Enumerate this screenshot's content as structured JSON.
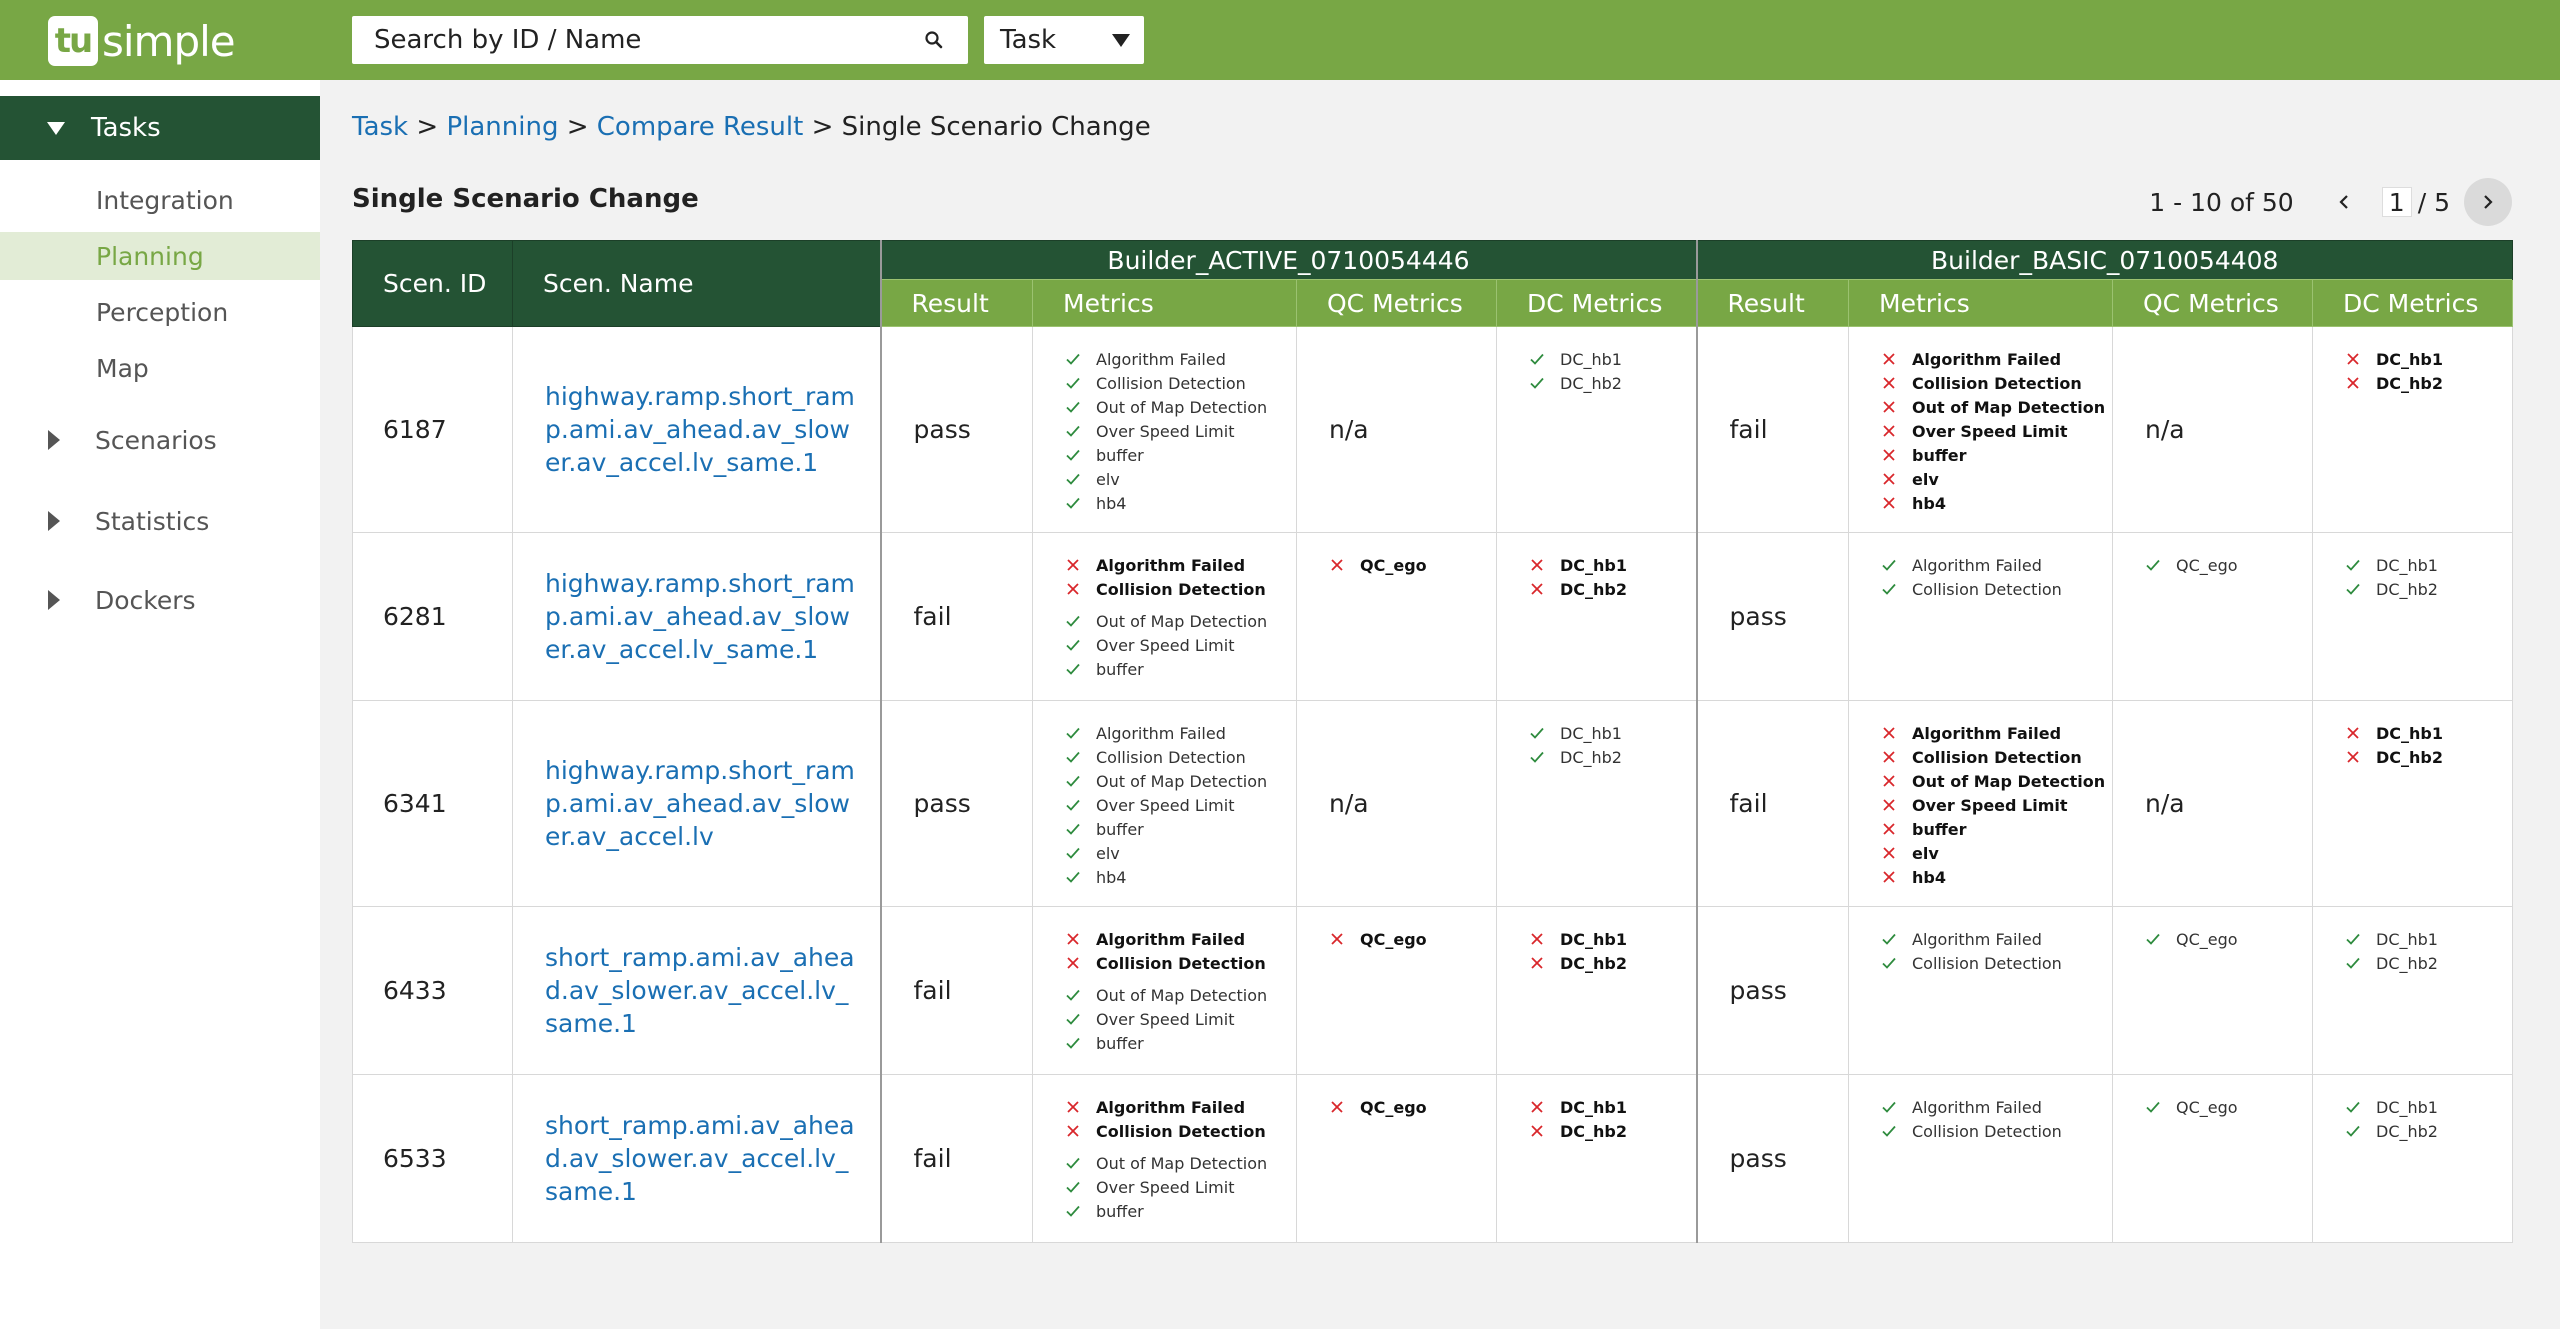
{
  "header": {
    "logo_badge": "tu",
    "logo_text": "simple",
    "search_placeholder": "Search by ID / Name",
    "search_icon": "magnifier",
    "type_select": "Task"
  },
  "sidebar": {
    "section": "Tasks",
    "sub_items": [
      "Integration",
      "Planning",
      "Perception",
      "Map"
    ],
    "active_item": "Planning",
    "groups": [
      "Scenarios",
      "Statistics",
      "Dockers"
    ]
  },
  "breadcrumb": {
    "items": [
      "Task",
      "Planning",
      "Compare Result"
    ],
    "current": "Single Scenario Change",
    "sep": ">"
  },
  "page_title": "Single Scenario Change",
  "pagination": {
    "range": "1 - 10 of 50",
    "page": "1",
    "total": "/ 5"
  },
  "table": {
    "col_id": "Scen. ID",
    "col_name": "Scen. Name",
    "builds": [
      "Builder_ACTIVE_0710054446",
      "Builder_BASIC_0710054408"
    ],
    "sub_cols": [
      "Result",
      "Metrics",
      "QC Metrics",
      "DC Metrics"
    ],
    "rows": [
      {
        "id": "6187",
        "name": "highway.ramp.short_ramp.ami.av_ahead.av_slower.av_accel.lv_same.1",
        "a": {
          "result": "pass",
          "qc": "n/a",
          "metrics": [
            [
              "Algorithm Failed",
              "ok"
            ],
            [
              "Collision Detection",
              "ok"
            ],
            [
              "Out of Map Detection",
              "ok"
            ],
            [
              "Over Speed Limit",
              "ok"
            ],
            [
              "buffer",
              "ok"
            ],
            [
              "elv",
              "ok"
            ],
            [
              "hb4",
              "ok"
            ]
          ],
          "dc": [
            [
              "DC_hb1",
              "ok"
            ],
            [
              "DC_hb2",
              "ok"
            ]
          ]
        },
        "b": {
          "result": "fail",
          "qc": "n/a",
          "metrics": [
            [
              "Algorithm Failed",
              "fail"
            ],
            [
              "Collision Detection",
              "fail"
            ],
            [
              "Out of Map Detection",
              "fail"
            ],
            [
              "Over Speed Limit",
              "fail"
            ],
            [
              "buffer",
              "fail"
            ],
            [
              "elv",
              "fail"
            ],
            [
              "hb4",
              "fail"
            ]
          ],
          "dc": [
            [
              "DC_hb1",
              "fail"
            ],
            [
              "DC_hb2",
              "fail"
            ]
          ]
        }
      },
      {
        "id": "6281",
        "name": "highway.ramp.short_ramp.ami.av_ahead.av_slower.av_accel.lv_same.1",
        "a": {
          "result": "fail",
          "qc": [
            [
              "QC_ego",
              "fail"
            ]
          ],
          "metrics": [
            [
              "Algorithm Failed",
              "fail"
            ],
            [
              "Collision Detection",
              "fail"
            ],
            [
              "Out of Map Detection",
              "ok"
            ],
            [
              "Over Speed Limit",
              "ok"
            ],
            [
              "buffer",
              "ok"
            ]
          ],
          "dc": [
            [
              "DC_hb1",
              "fail"
            ],
            [
              "DC_hb2",
              "fail"
            ]
          ]
        },
        "b": {
          "result": "pass",
          "qc": [
            [
              "QC_ego",
              "ok"
            ]
          ],
          "metrics": [
            [
              "Algorithm Failed",
              "ok"
            ],
            [
              "Collision Detection",
              "ok"
            ]
          ],
          "dc": [
            [
              "DC_hb1",
              "ok"
            ],
            [
              "DC_hb2",
              "ok"
            ]
          ]
        }
      },
      {
        "id": "6341",
        "name": "highway.ramp.short_ramp.ami.av_ahead.av_slower.av_accel.lv",
        "a": {
          "result": "pass",
          "qc": "n/a",
          "metrics": [
            [
              "Algorithm Failed",
              "ok"
            ],
            [
              "Collision Detection",
              "ok"
            ],
            [
              "Out of Map Detection",
              "ok"
            ],
            [
              "Over Speed Limit",
              "ok"
            ],
            [
              "buffer",
              "ok"
            ],
            [
              "elv",
              "ok"
            ],
            [
              "hb4",
              "ok"
            ]
          ],
          "dc": [
            [
              "DC_hb1",
              "ok"
            ],
            [
              "DC_hb2",
              "ok"
            ]
          ]
        },
        "b": {
          "result": "fail",
          "qc": "n/a",
          "metrics": [
            [
              "Algorithm Failed",
              "fail"
            ],
            [
              "Collision Detection",
              "fail"
            ],
            [
              "Out of Map Detection",
              "fail"
            ],
            [
              "Over Speed Limit",
              "fail"
            ],
            [
              "buffer",
              "fail"
            ],
            [
              "elv",
              "fail"
            ],
            [
              "hb4",
              "fail"
            ]
          ],
          "dc": [
            [
              "DC_hb1",
              "fail"
            ],
            [
              "DC_hb2",
              "fail"
            ]
          ]
        }
      },
      {
        "id": "6433",
        "name": "short_ramp.ami.av_ahead.av_slower.av_accel.lv_same.1",
        "a": {
          "result": "fail",
          "qc": [
            [
              "QC_ego",
              "fail"
            ]
          ],
          "metrics": [
            [
              "Algorithm Failed",
              "fail"
            ],
            [
              "Collision Detection",
              "fail"
            ],
            [
              "Out of Map Detection",
              "ok"
            ],
            [
              "Over Speed Limit",
              "ok"
            ],
            [
              "buffer",
              "ok"
            ]
          ],
          "dc": [
            [
              "DC_hb1",
              "fail"
            ],
            [
              "DC_hb2",
              "fail"
            ]
          ]
        },
        "b": {
          "result": "pass",
          "qc": [
            [
              "QC_ego",
              "ok"
            ]
          ],
          "metrics": [
            [
              "Algorithm Failed",
              "ok"
            ],
            [
              "Collision Detection",
              "ok"
            ]
          ],
          "dc": [
            [
              "DC_hb1",
              "ok"
            ],
            [
              "DC_hb2",
              "ok"
            ]
          ]
        }
      },
      {
        "id": "6533",
        "name": "short_ramp.ami.av_ahead.av_slower.av_accel.lv_same.1",
        "a": {
          "result": "fail",
          "qc": [
            [
              "QC_ego",
              "fail"
            ]
          ],
          "metrics": [
            [
              "Algorithm Failed",
              "fail"
            ],
            [
              "Collision Detection",
              "fail"
            ],
            [
              "Out of Map Detection",
              "ok"
            ],
            [
              "Over Speed Limit",
              "ok"
            ],
            [
              "buffer",
              "ok"
            ]
          ],
          "dc": [
            [
              "DC_hb1",
              "fail"
            ],
            [
              "DC_hb2",
              "fail"
            ]
          ]
        },
        "b": {
          "result": "pass",
          "qc": [
            [
              "QC_ego",
              "ok"
            ]
          ],
          "metrics": [
            [
              "Algorithm Failed",
              "ok"
            ],
            [
              "Collision Detection",
              "ok"
            ]
          ],
          "dc": [
            [
              "DC_hb1",
              "ok"
            ],
            [
              "DC_hb2",
              "ok"
            ]
          ]
        }
      }
    ]
  },
  "colors": {
    "brand_green": "#78a745",
    "dark_green": "#245334",
    "link_blue": "#1a6fb3",
    "ok_green": "#2e8b3e",
    "fail_red": "#d9262b"
  }
}
